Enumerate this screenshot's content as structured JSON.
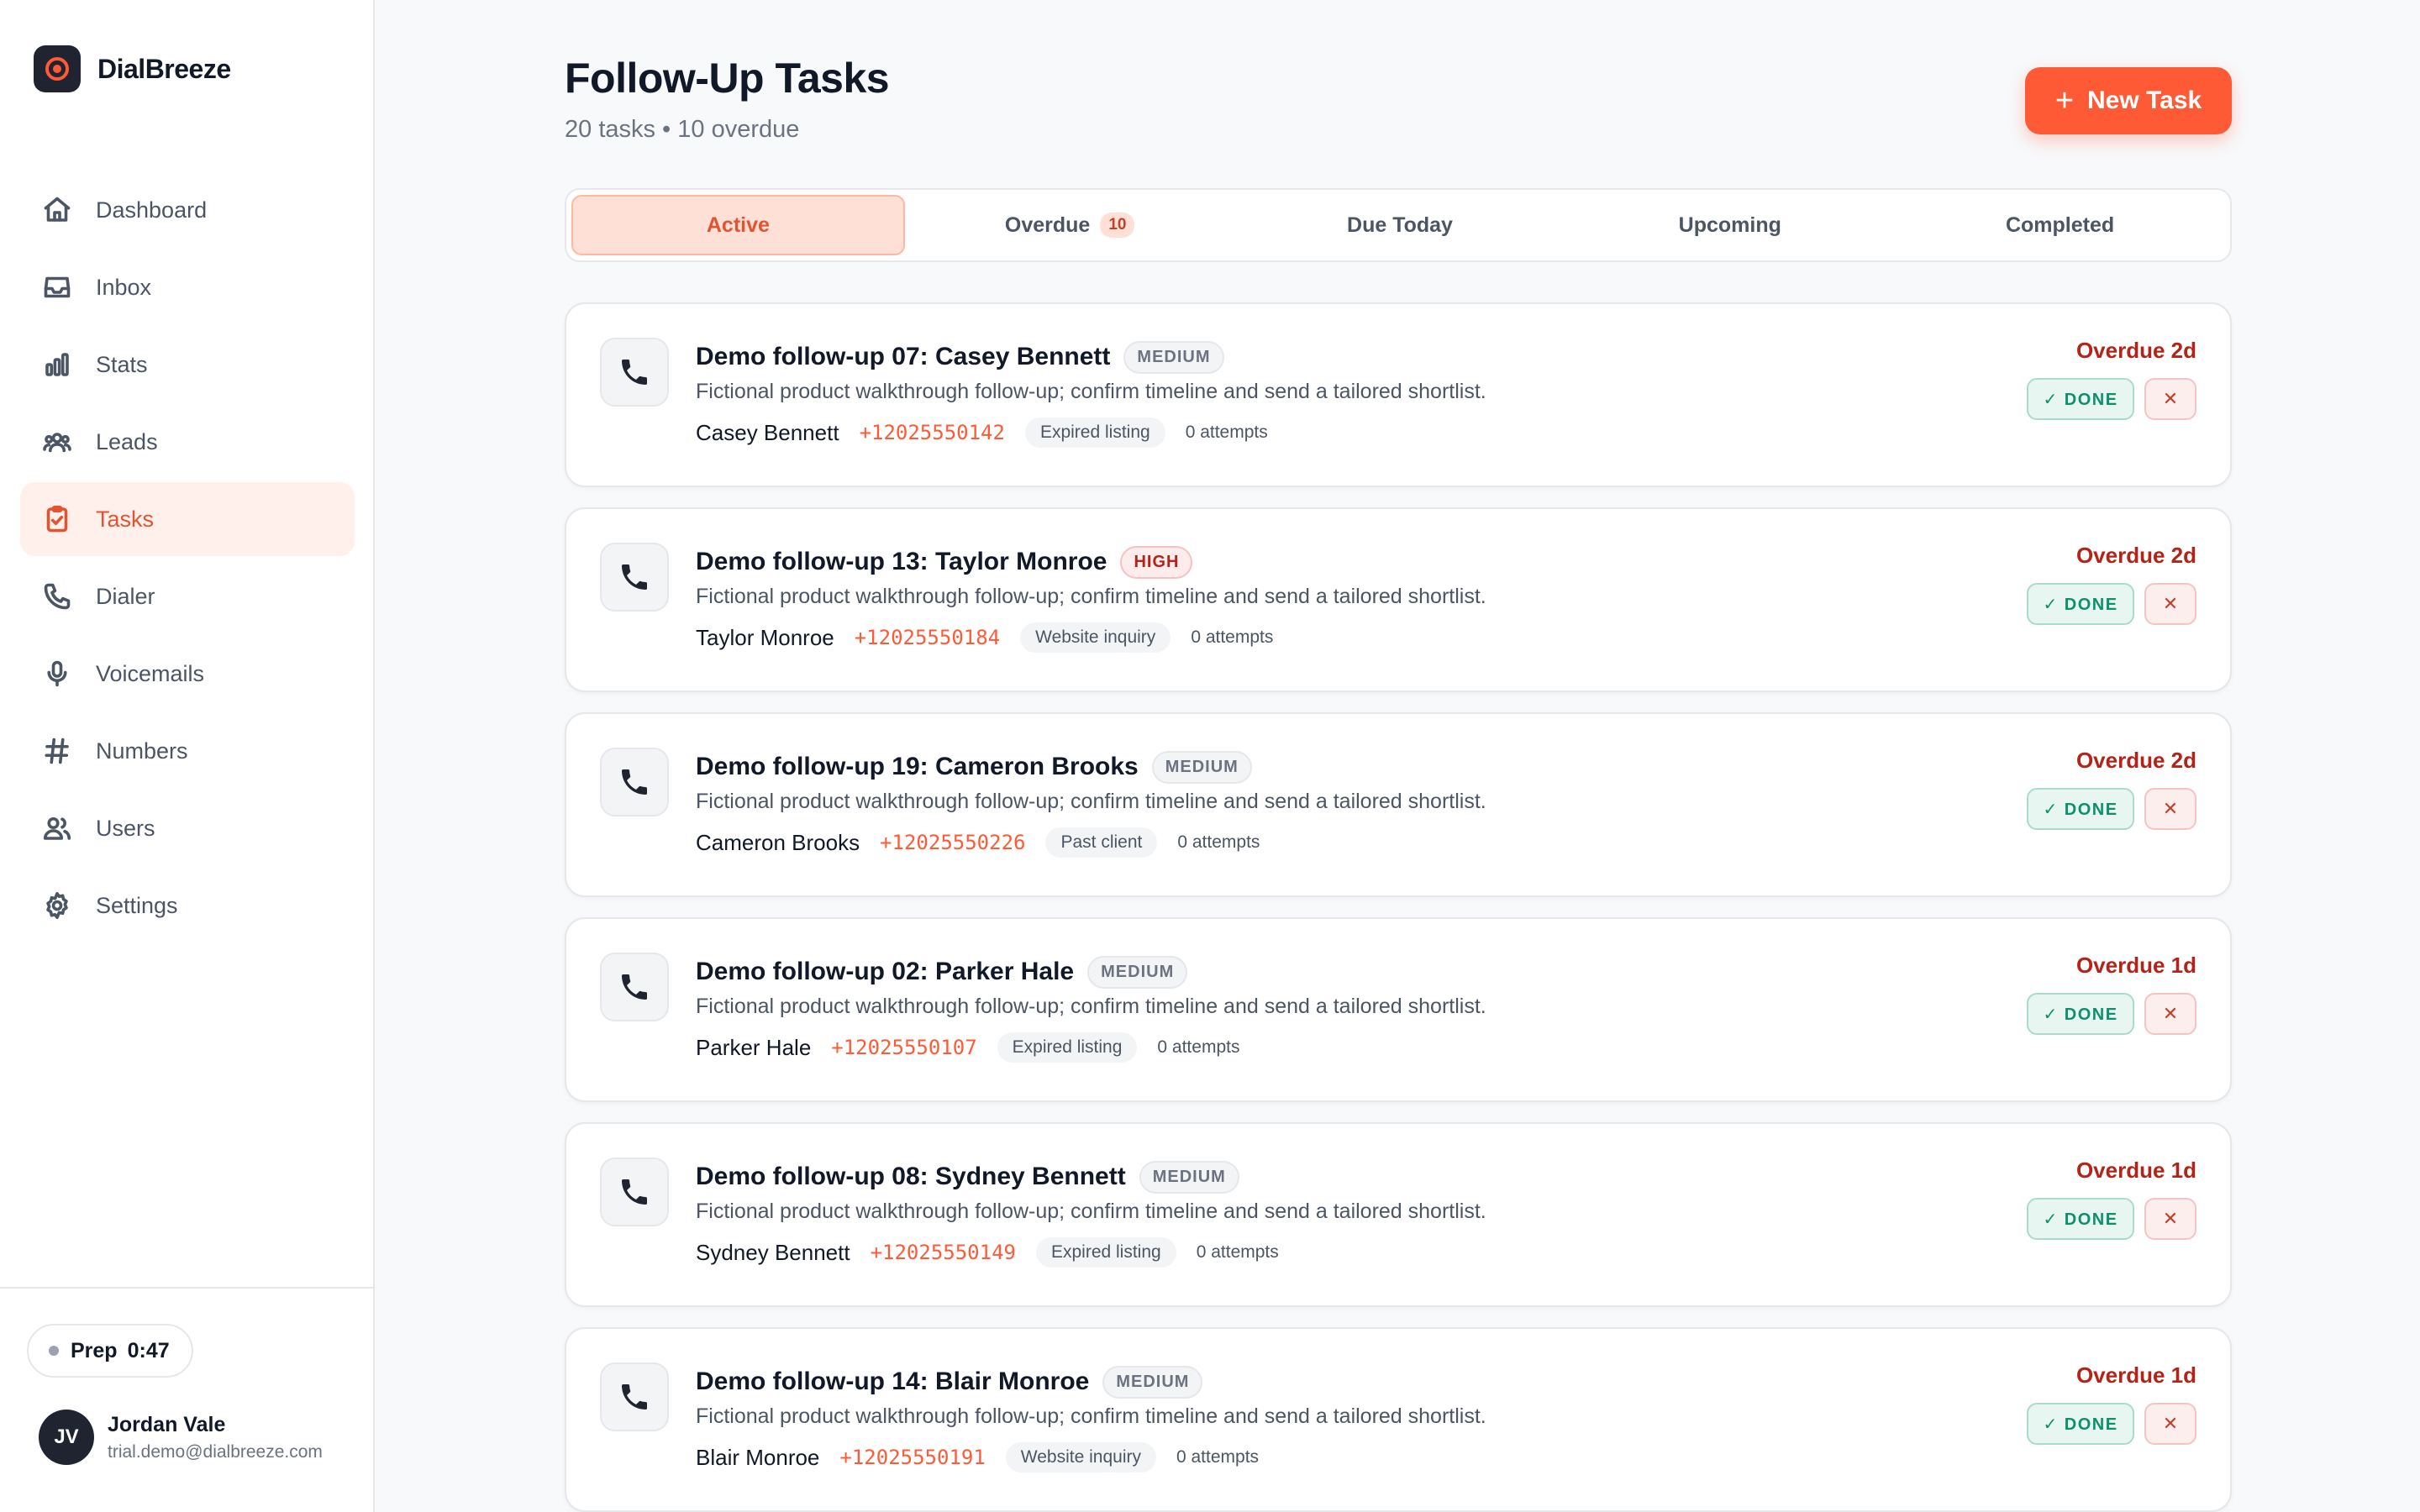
{
  "app": {
    "name": "DialBreeze"
  },
  "nav": [
    {
      "label": "Dashboard",
      "icon": "home-icon",
      "active": false
    },
    {
      "label": "Inbox",
      "icon": "inbox-icon",
      "active": false
    },
    {
      "label": "Stats",
      "icon": "bar-chart-icon",
      "active": false
    },
    {
      "label": "Leads",
      "icon": "people-group-icon",
      "active": false
    },
    {
      "label": "Tasks",
      "icon": "clipboard-icon",
      "active": true
    },
    {
      "label": "Dialer",
      "icon": "phone-icon",
      "active": false
    },
    {
      "label": "Voicemails",
      "icon": "microphone-icon",
      "active": false
    },
    {
      "label": "Numbers",
      "icon": "hash-icon",
      "active": false
    },
    {
      "label": "Users",
      "icon": "users-icon",
      "active": false
    },
    {
      "label": "Settings",
      "icon": "gear-icon",
      "active": false
    }
  ],
  "prep": {
    "label": "Prep",
    "time": "0:47"
  },
  "user": {
    "initials": "JV",
    "name": "Jordan Vale",
    "email": "trial.demo@dialbreeze.com"
  },
  "header": {
    "title": "Follow-Up Tasks",
    "subtitle": "20 tasks • 10 overdue",
    "new_task_label": "New Task"
  },
  "tabs": [
    {
      "label": "Active",
      "count": "",
      "active": true
    },
    {
      "label": "Overdue",
      "count": "10",
      "active": false
    },
    {
      "label": "Due Today",
      "count": "",
      "active": false
    },
    {
      "label": "Upcoming",
      "count": "",
      "active": false
    },
    {
      "label": "Completed",
      "count": "",
      "active": false
    }
  ],
  "actions": {
    "done_label": "✓ DONE",
    "dismiss_label": "✕"
  },
  "tasks": [
    {
      "title": "Demo follow-up 07: Casey Bennett",
      "priority": "MEDIUM",
      "description": "Fictional product walkthrough follow-up; confirm timeline and send a tailored shortlist.",
      "contact": "Casey Bennett",
      "phone": "+12025550142",
      "source": "Expired listing",
      "attempts": "0 attempts",
      "due": "Overdue 2d"
    },
    {
      "title": "Demo follow-up 13: Taylor Monroe",
      "priority": "HIGH",
      "description": "Fictional product walkthrough follow-up; confirm timeline and send a tailored shortlist.",
      "contact": "Taylor Monroe",
      "phone": "+12025550184",
      "source": "Website inquiry",
      "attempts": "0 attempts",
      "due": "Overdue 2d"
    },
    {
      "title": "Demo follow-up 19: Cameron Brooks",
      "priority": "MEDIUM",
      "description": "Fictional product walkthrough follow-up; confirm timeline and send a tailored shortlist.",
      "contact": "Cameron Brooks",
      "phone": "+12025550226",
      "source": "Past client",
      "attempts": "0 attempts",
      "due": "Overdue 2d"
    },
    {
      "title": "Demo follow-up 02: Parker Hale",
      "priority": "MEDIUM",
      "description": "Fictional product walkthrough follow-up; confirm timeline and send a tailored shortlist.",
      "contact": "Parker Hale",
      "phone": "+12025550107",
      "source": "Expired listing",
      "attempts": "0 attempts",
      "due": "Overdue 1d"
    },
    {
      "title": "Demo follow-up 08: Sydney Bennett",
      "priority": "MEDIUM",
      "description": "Fictional product walkthrough follow-up; confirm timeline and send a tailored shortlist.",
      "contact": "Sydney Bennett",
      "phone": "+12025550149",
      "source": "Expired listing",
      "attempts": "0 attempts",
      "due": "Overdue 1d"
    },
    {
      "title": "Demo follow-up 14: Blair Monroe",
      "priority": "MEDIUM",
      "description": "Fictional product walkthrough follow-up; confirm timeline and send a tailored shortlist.",
      "contact": "Blair Monroe",
      "phone": "+12025550191",
      "source": "Website inquiry",
      "attempts": "0 attempts",
      "due": "Overdue 1d"
    }
  ],
  "colors": {
    "accent": "#ff5a36",
    "overdue": "#b42318",
    "done": "#0f8f6b"
  }
}
